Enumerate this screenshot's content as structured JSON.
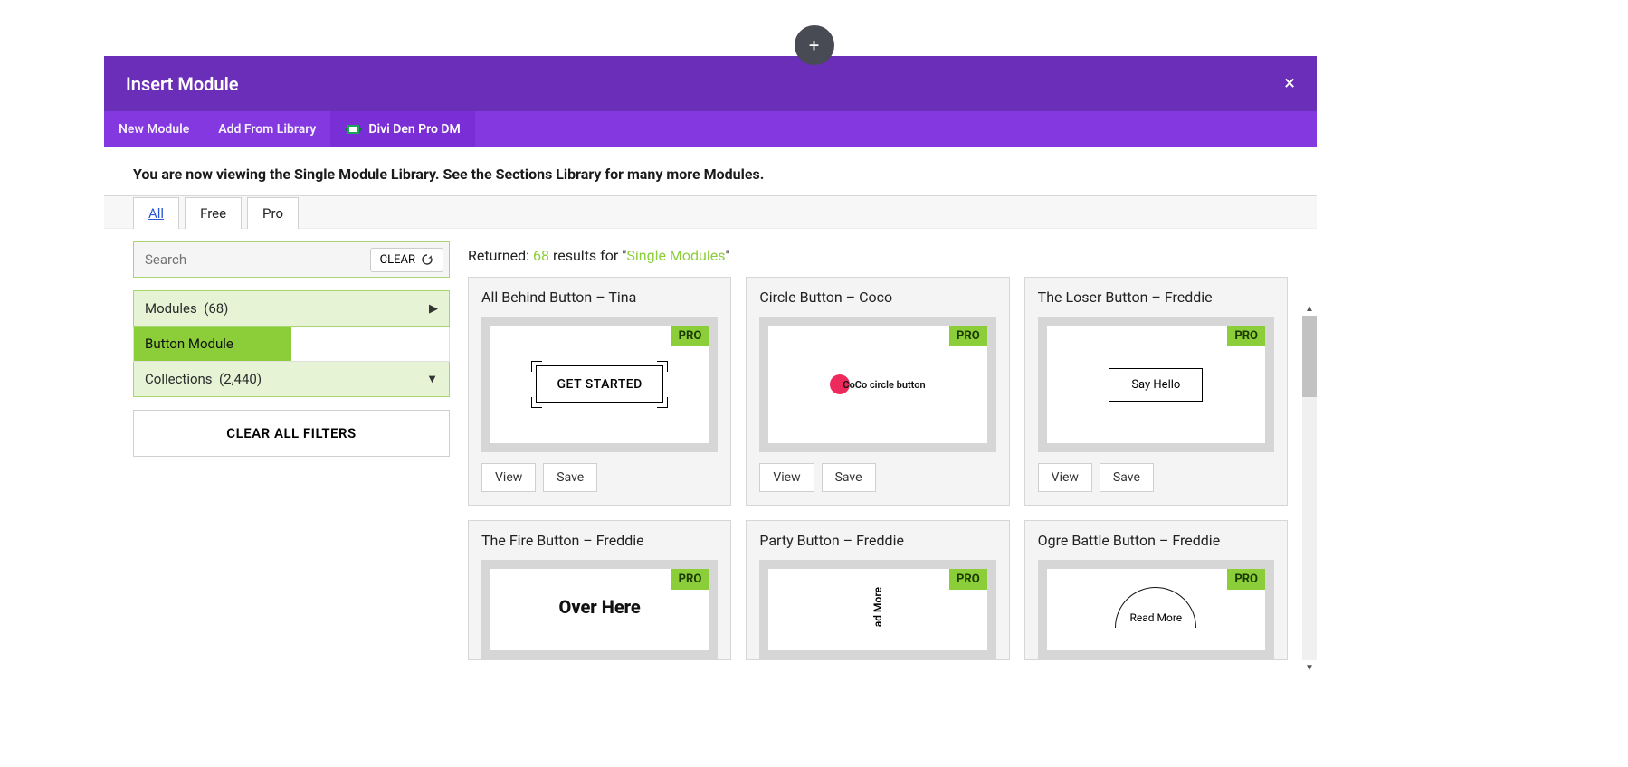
{
  "floating_add": "+",
  "modal": {
    "title": "Insert Module",
    "close": "×",
    "tabs": {
      "new_module": "New Module",
      "add_from_library": "Add From Library",
      "divi_den": "Divi Den Pro DM"
    },
    "intro": "You are now viewing the Single Module Library. See the Sections Library for many more Modules.",
    "filter_tabs": {
      "all": "All",
      "free": "Free",
      "pro": "Pro"
    },
    "sidebar": {
      "search_placeholder": "Search",
      "clear_label": "CLEAR",
      "modules_label": "Modules",
      "modules_count": "(68)",
      "button_module_label": "Button Module",
      "collections_label": "Collections",
      "collections_count": "(2,440)",
      "clear_all": "CLEAR ALL FILTERS"
    },
    "results": {
      "prefix": "Returned: ",
      "count": "68",
      "mid": " results for \"",
      "query": "Single Modules",
      "suffix": "\""
    },
    "badges": {
      "pro": "PRO"
    },
    "actions": {
      "view": "View",
      "save": "Save"
    },
    "cards": [
      {
        "title": "All Behind Button – Tina",
        "preview_text": "GET STARTED",
        "pro": true
      },
      {
        "title": "Circle Button – Coco",
        "preview_text": "CoCo circle button",
        "pro": true
      },
      {
        "title": "The Loser Button – Freddie",
        "preview_text": "Say Hello",
        "pro": true
      },
      {
        "title": "The Fire Button – Freddie",
        "preview_text": "Over Here",
        "pro": true
      },
      {
        "title": "Party Button – Freddie",
        "preview_text": "ad More",
        "pro": true
      },
      {
        "title": "Ogre Battle Button – Freddie",
        "preview_text": "Read More",
        "pro": true
      }
    ]
  }
}
